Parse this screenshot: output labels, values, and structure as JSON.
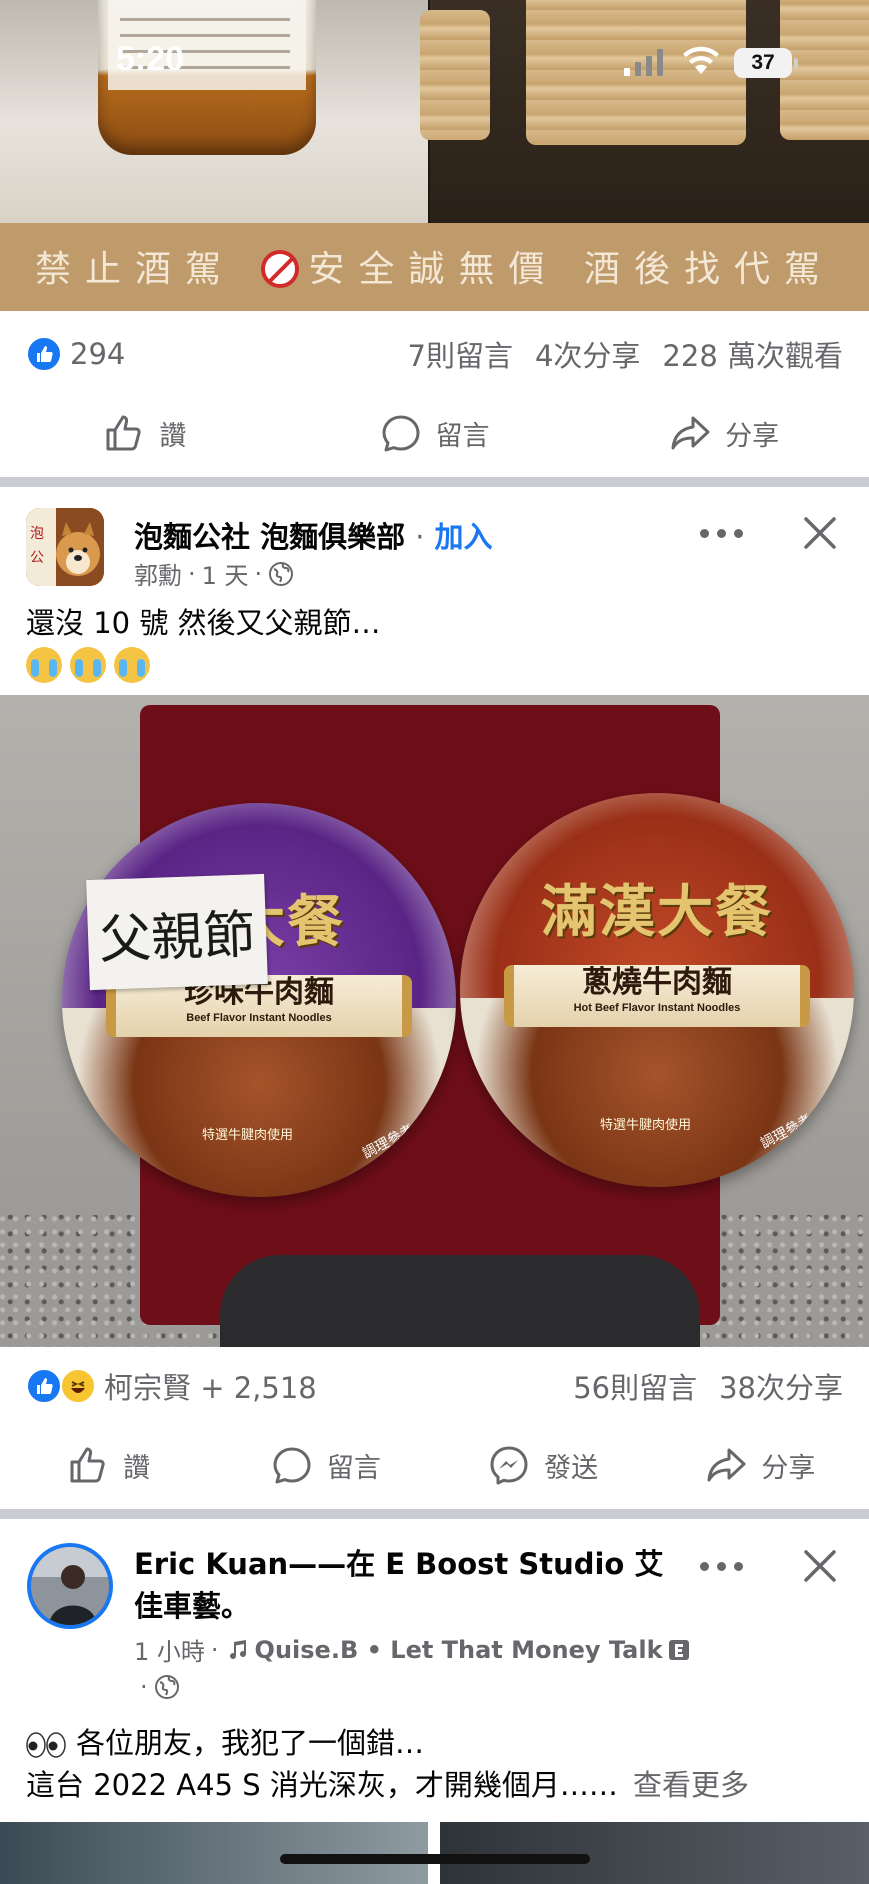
{
  "status_bar": {
    "time": "5:20",
    "battery": "37"
  },
  "video_post": {
    "banner_left": "禁止酒駕",
    "banner_right": "安全誠無價 酒後找代駕",
    "like_count": "294",
    "comments": "7則留言",
    "shares": "4次分享",
    "views": "228 萬次觀看",
    "actions": {
      "like": "讚",
      "comment": "留言",
      "share": "分享"
    }
  },
  "group_post": {
    "group_name": "泡麵公社 泡麵俱樂部",
    "separator": "·",
    "join_label": "加入",
    "author": "郭勳",
    "time": "1 天",
    "text_line1": "還沒 10 號  然後又父親節…",
    "photo": {
      "left_cup": {
        "brand": "大餐",
        "flavor": "珍味牛肉麵",
        "english": "Beef Flavor Instant Noodles",
        "note": "父親節",
        "tag": "特選牛腱肉使用",
        "tag2": "調理參考"
      },
      "right_cup": {
        "brand": "滿漢大餐",
        "flavor": "蔥燒牛肉麵",
        "english": "Hot Beef Flavor Instant Noodles",
        "tag": "特選牛腱肉使用",
        "tag2": "調理參考"
      }
    },
    "reactions": "柯宗賢 + 2,518",
    "comments": "56則留言",
    "shares": "38次分享",
    "actions": {
      "like": "讚",
      "comment": "留言",
      "send": "發送",
      "share": "分享"
    }
  },
  "eric_post": {
    "name_line1": "Eric Kuan——在 E Boost Studio 艾",
    "name_line2": "佳車藝。",
    "time": "1 小時",
    "music": "Quise.B • Let That Money Talk",
    "text_line1": "各位朋友，我犯了一個錯…",
    "text_line2": "這台 2022 A45 S 消光深灰，才開幾個月……",
    "see_more": "查看更多"
  },
  "colors": {
    "facebook_blue": "#1877f2",
    "meta_gray": "#65676b",
    "separator": "#c9ccd1",
    "banner": "#bf9a6b"
  }
}
